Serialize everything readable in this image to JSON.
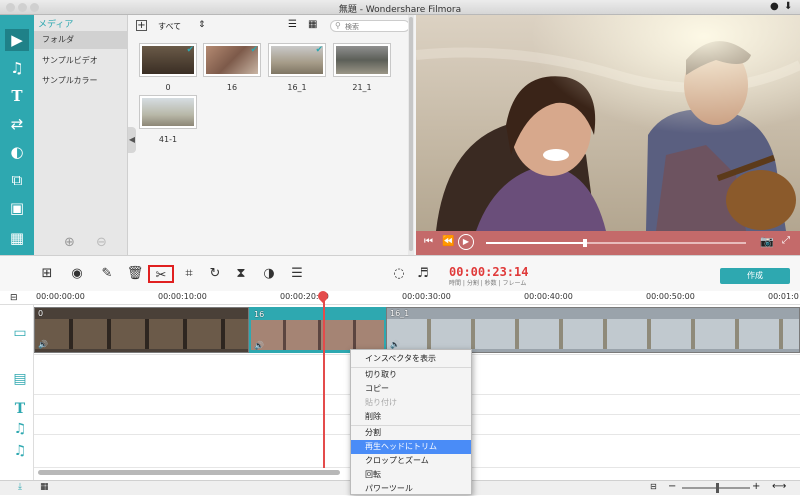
{
  "window": {
    "title": "無題 - Wondershare Filmora"
  },
  "nav": {
    "header": "メディア",
    "items": [
      {
        "label": "フォルダ"
      },
      {
        "label": "サンプルビデオ"
      },
      {
        "label": "サンプルカラー"
      }
    ]
  },
  "media": {
    "filter_label": "すべて",
    "search_placeholder": "検索",
    "items": [
      {
        "label": "0",
        "checked": true
      },
      {
        "label": "16",
        "checked": true
      },
      {
        "label": "16_1",
        "checked": true
      },
      {
        "label": "21_1",
        "checked": false
      },
      {
        "label": "41-1",
        "checked": false
      }
    ]
  },
  "player": {
    "progress_fraction": 0.38
  },
  "toolbar": {
    "timecode": "00:00:23:14",
    "timecode_sub": "時間 | 分割 | 秒数 | フレーム",
    "export_label": "作成"
  },
  "ruler": {
    "labels": [
      "00:00:00:00",
      "00:00:10:00",
      "00:00:20:00",
      "00:00:30:00",
      "00:00:40:00",
      "00:00:50:00",
      "00:01:0"
    ]
  },
  "timeline": {
    "clips": [
      {
        "label": "0"
      },
      {
        "label": "16"
      },
      {
        "label": "16_1"
      }
    ]
  },
  "context_menu": {
    "items": [
      {
        "label": "インスペクタを表示",
        "state": "normal"
      },
      {
        "label": "切り取り",
        "state": "normal"
      },
      {
        "label": "コピー",
        "state": "normal"
      },
      {
        "label": "貼り付け",
        "state": "disabled"
      },
      {
        "label": "削除",
        "state": "normal"
      },
      {
        "label": "分割",
        "state": "normal"
      },
      {
        "label": "再生ヘッドにトリム",
        "state": "highlighted"
      },
      {
        "label": "クロップとズーム",
        "state": "normal"
      },
      {
        "label": "回転",
        "state": "normal"
      },
      {
        "label": "パワーツール",
        "state": "normal"
      }
    ]
  },
  "colors": {
    "accent": "#2ea8b0",
    "playhead": "#e44b4b",
    "highlight": "#4a8cf7",
    "timecode": "#e03a3a"
  }
}
